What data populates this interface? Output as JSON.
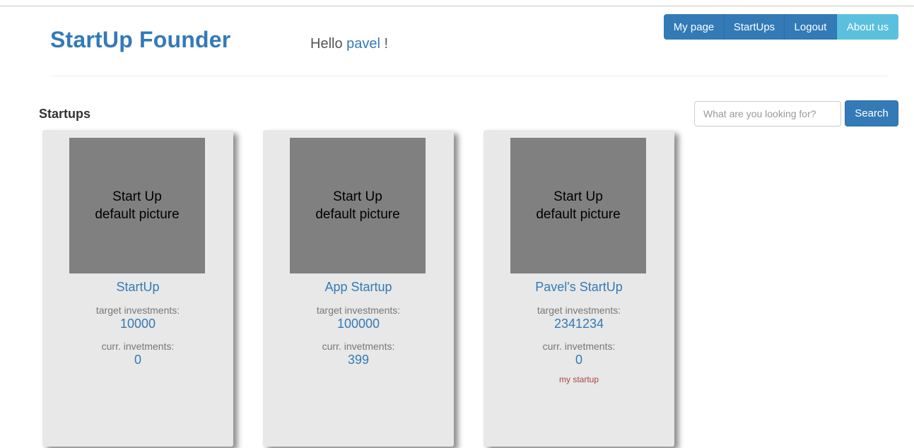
{
  "header": {
    "brand": "StartUp Founder",
    "greeting_prefix": "Hello",
    "username": "pavel",
    "greeting_suffix": "!"
  },
  "nav": {
    "items": [
      {
        "label": "My page"
      },
      {
        "label": "StartUps"
      },
      {
        "label": "Logout"
      },
      {
        "label": "About us"
      }
    ]
  },
  "main": {
    "section_title": "Startups",
    "search": {
      "placeholder": "What are you looking for?",
      "value": "",
      "button_label": "Search"
    },
    "startups": [
      {
        "picture_line1": "Start Up",
        "picture_line2": "default picture",
        "name": "StartUp",
        "target_label": "target investments:",
        "target_value": "10000",
        "current_label": "curr. invetments:",
        "current_value": "0",
        "badge": ""
      },
      {
        "picture_line1": "Start Up",
        "picture_line2": "default picture",
        "name": "App Startup",
        "target_label": "target investments:",
        "target_value": "100000",
        "current_label": "curr. invetments:",
        "current_value": "399",
        "badge": ""
      },
      {
        "picture_line1": "Start Up",
        "picture_line2": "default picture",
        "name": "Pavel's StartUp",
        "target_label": "target investments:",
        "target_value": "2341234",
        "current_label": "curr. invetments:",
        "current_value": "0",
        "badge": "my startup"
      }
    ]
  },
  "colors": {
    "primary": "#337ab7",
    "info": "#5bc0de",
    "card_bg": "#e8e8e8",
    "picture_bg": "#808080",
    "badge": "#a94442"
  }
}
